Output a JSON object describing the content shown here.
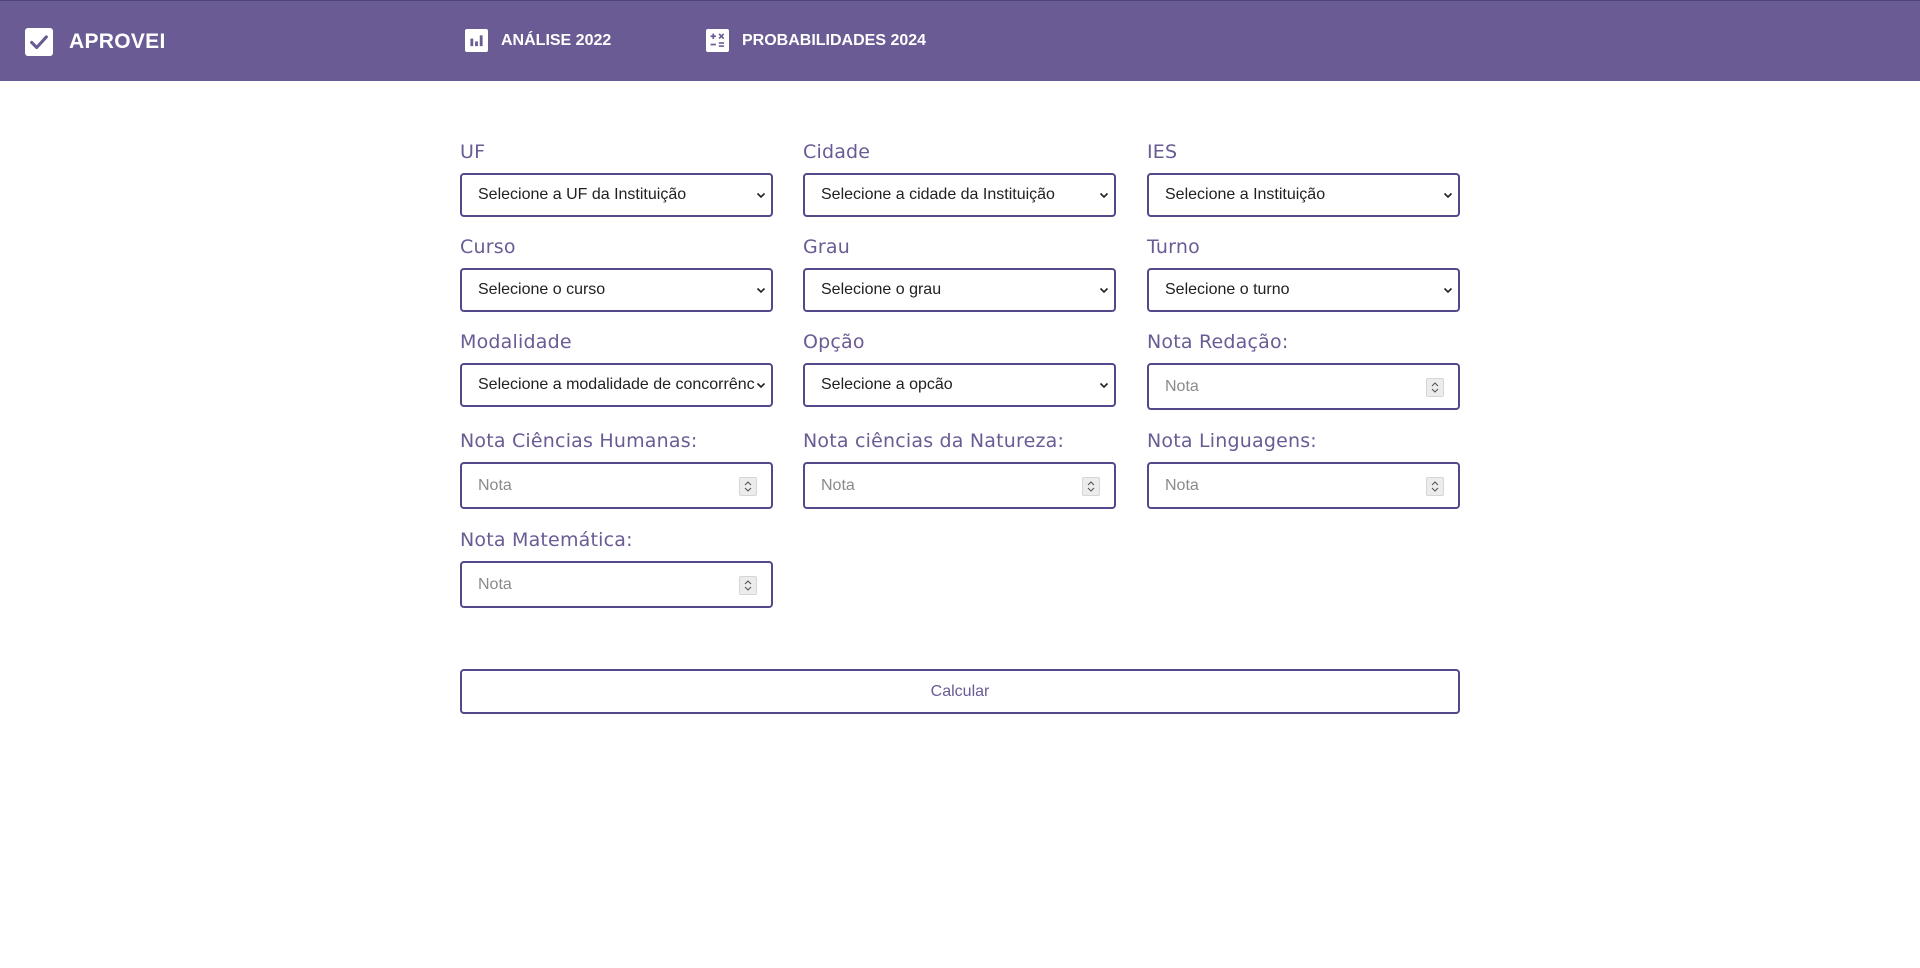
{
  "navbar": {
    "brand_label": "APROVEI",
    "brand_icon": "check-box-icon",
    "items": [
      {
        "label": "ANÁLISE 2022",
        "icon": "bar-chart-icon"
      },
      {
        "label": "PROBABILIDADES 2024",
        "icon": "calculator-icon"
      }
    ],
    "background_color": "#6a5b94"
  },
  "form": {
    "uf": {
      "label": "UF",
      "value": "Selecione a UF da Instituição"
    },
    "cidade": {
      "label": "Cidade",
      "value": "Selecione a cidade da Instituição"
    },
    "ies": {
      "label": "IES",
      "value": "Selecione a Instituição"
    },
    "curso": {
      "label": "Curso",
      "value": "Selecione o curso"
    },
    "grau": {
      "label": "Grau",
      "value": "Selecione o grau"
    },
    "turno": {
      "label": "Turno",
      "value": "Selecione o turno"
    },
    "modalidade": {
      "label": "Modalidade",
      "value": "Selecione a modalidade de concorrência"
    },
    "opcao": {
      "label": "Opção",
      "value": "Selecione a opcão"
    },
    "nota_redacao": {
      "label": "Nota Redação:",
      "placeholder": "Nota"
    },
    "nota_humanas": {
      "label": "Nota Ciências Humanas:",
      "placeholder": "Nota"
    },
    "nota_natureza": {
      "label": "Nota ciências da Natureza:",
      "placeholder": "Nota"
    },
    "nota_linguagens": {
      "label": "Nota Linguagens:",
      "placeholder": "Nota"
    },
    "nota_matematica": {
      "label": "Nota Matemática:",
      "placeholder": "Nota"
    },
    "submit_label": "Calcular"
  },
  "colors": {
    "accent": "#6a5b94",
    "border": "#55488a"
  }
}
